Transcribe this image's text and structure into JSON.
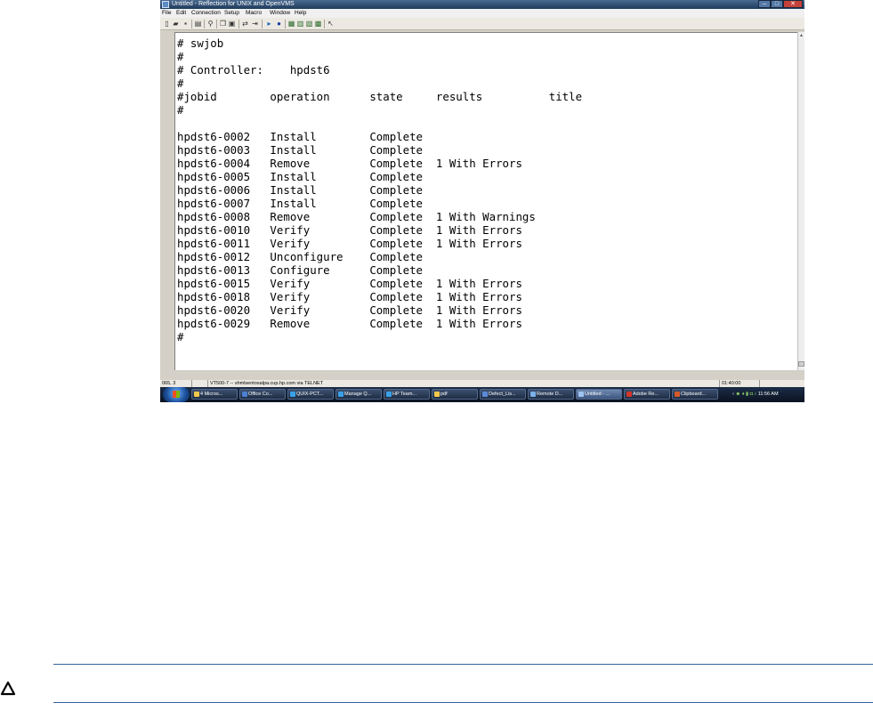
{
  "window": {
    "title": "Untitled - Reflection for UNIX and OpenVMS",
    "controls": {
      "minimize": "–",
      "maximize": "□",
      "close": "✕"
    }
  },
  "menu": [
    "File",
    "Edit",
    "Connection",
    "Setup",
    "Macro",
    "Window",
    "Help"
  ],
  "toolbar_icons": [
    "new-icon",
    "open-icon",
    "save-icon",
    "print-icon",
    "find-icon",
    "copy-icon",
    "paste-icon",
    "connect-icon",
    "disconnect-icon",
    "play-icon",
    "record-icon",
    "settings-icon",
    "keyboard-icon",
    "display-icon",
    "macro-icon",
    "help-icon"
  ],
  "terminal": {
    "lines": [
      "# swjob",
      "#",
      "# Controller:    hpdst6",
      "#",
      "#jobid        operation      state     results          title",
      "#",
      "",
      "hpdst6-0002   Install        Complete",
      "hpdst6-0003   Install        Complete",
      "hpdst6-0004   Remove         Complete  1 With Errors",
      "hpdst6-0005   Install        Complete",
      "hpdst6-0006   Install        Complete",
      "hpdst6-0007   Install        Complete",
      "hpdst6-0008   Remove         Complete  1 With Warnings",
      "hpdst6-0010   Verify         Complete  1 With Errors",
      "hpdst6-0011   Verify         Complete  1 With Errors",
      "hpdst6-0012   Unconfigure    Complete",
      "hpdst6-0013   Configure      Complete",
      "hpdst6-0015   Verify         Complete  1 With Errors",
      "hpdst6-0018   Verify         Complete  1 With Errors",
      "hpdst6-0020   Verify         Complete  1 With Errors",
      "hpdst6-0029   Remove         Complete  1 With Errors",
      "#"
    ]
  },
  "status": {
    "position": "065, 3",
    "terminal_type": "VT500-7 -- shmlsentosalpa.cup.hp.com via TELNET",
    "timer": "01:40:00"
  },
  "taskbar": {
    "items": [
      "4 Micros...",
      "Office Co...",
      "QUIX-PCT...",
      "Manage Q...",
      "HP Team...",
      "pdf",
      "Defect_Lis...",
      "Remote D...",
      "Untitled - ...",
      "Adobe Re...",
      "Clipboard..."
    ],
    "clock": "11:56 AM"
  }
}
